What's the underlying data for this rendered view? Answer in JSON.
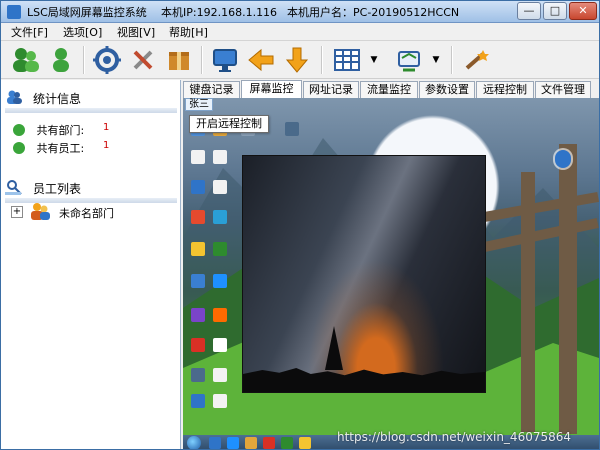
{
  "window": {
    "app_title": "LSC局域网屏幕监控系统",
    "ip_label": "本机IP:192.168.1.116",
    "user_label": "本机用户名：PC-20190512HCCN",
    "buttons": {
      "minimize": "—",
      "maximize": "□",
      "close": "✕"
    }
  },
  "menu": {
    "items": [
      "文件[F]",
      "选项[O]",
      "视图[V]",
      "帮助[H]"
    ]
  },
  "toolbar": {
    "icons": [
      "users-icon",
      "user-icon",
      "settings-gear-icon",
      "tools-icon",
      "package-icon",
      "monitor-icon",
      "arrow-left-icon",
      "arrow-down-icon",
      "grid-view-icon",
      "network-refresh-icon",
      "wand-icon"
    ],
    "dropdown_glyph": "▼"
  },
  "left": {
    "stats": {
      "title": "统计信息",
      "departments_label": "共有部门:",
      "departments_value": "1",
      "employees_label": "共有员工:",
      "employees_value": "1"
    },
    "employees": {
      "title": "员工列表",
      "expander": "+",
      "department_label": "未命名部门"
    }
  },
  "tabs": {
    "items": [
      "键盘记录",
      "屏幕监控",
      "网址记录",
      "流量监控",
      "参数设置",
      "远程控制",
      "文件管理"
    ],
    "active_index": 1
  },
  "screen": {
    "user_badge": "张三",
    "tooltip": "开启远程控制",
    "watermark": "https://blog.csdn.net/weixin_46075864"
  },
  "colors": {
    "accent": "#2f74c8",
    "stat_value": "#cc0000"
  }
}
